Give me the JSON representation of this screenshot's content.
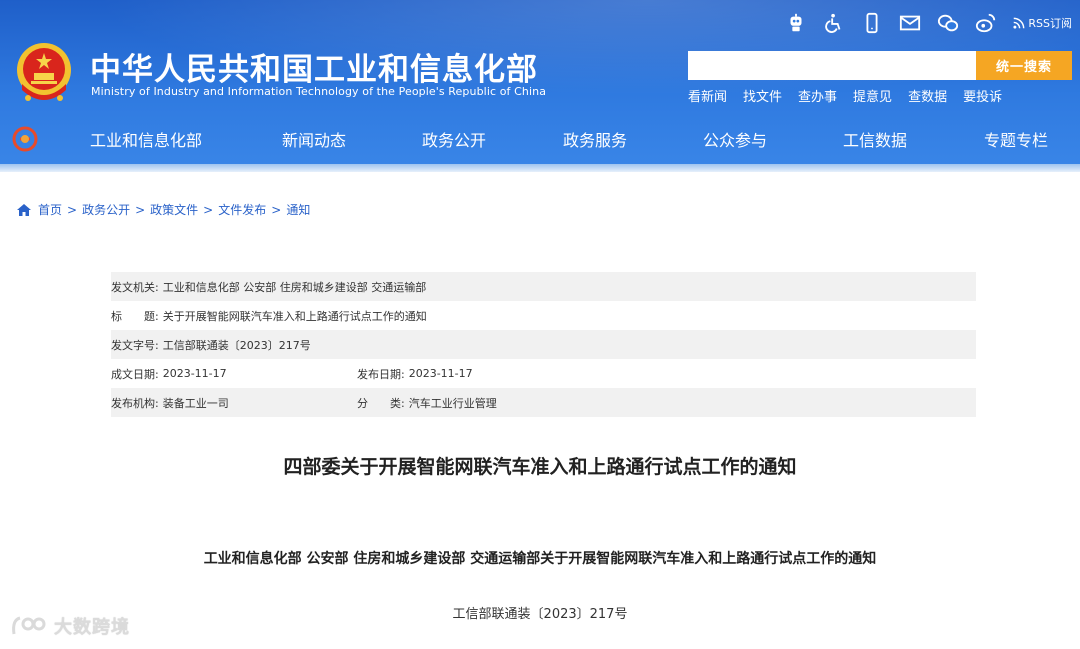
{
  "header": {
    "site_title_cn": "中华人民共和国工业和信息化部",
    "site_title_en": "Ministry of Industry and Information Technology of the People's Republic of China",
    "utility_icons": [
      "robot-icon",
      "accessibility-icon",
      "mobile-icon",
      "mail-icon",
      "wechat-icon",
      "weibo-icon"
    ],
    "rss_label": "RSS订阅",
    "search": {
      "placeholder": "",
      "button_label": "统一搜索"
    },
    "quick_links": [
      "看新闻",
      "找文件",
      "查办事",
      "提意见",
      "查数据",
      "要投诉"
    ],
    "colors": {
      "header_blue": "#2f7ae0",
      "search_button": "#f5a623",
      "link_blue": "#2a62c9"
    }
  },
  "nav": {
    "items": [
      "工业和信息化部",
      "新闻动态",
      "政务公开",
      "政务服务",
      "公众参与",
      "工信数据",
      "专题专栏"
    ]
  },
  "breadcrumb": [
    "首页",
    "政务公开",
    "政策文件",
    "文件发布",
    "通知"
  ],
  "breadcrumb_sep": ">",
  "meta": {
    "issuer_label": "发文机关:",
    "issuer": "工业和信息化部 公安部 住房和城乡建设部 交通运输部",
    "title_label": "标　　题:",
    "title": "关于开展智能网联汽车准入和上路通行试点工作的通知",
    "docno_label": "发文字号:",
    "docno": "工信部联通装〔2023〕217号",
    "created_label": "成文日期:",
    "created": "2023-11-17",
    "published_label": "发布日期:",
    "published": "2023-11-17",
    "org_label": "发布机构:",
    "org": "装备工业一司",
    "category_label": "分　　类:",
    "category": "汽车工业行业管理"
  },
  "article": {
    "title": "四部委关于开展智能网联汽车准入和上路通行试点工作的通知",
    "subtitle": "工业和信息化部 公安部 住房和城乡建设部 交通运输部关于开展智能网联汽车准入和上路通行试点工作的通知",
    "docno": "工信部联通装〔2023〕217号"
  },
  "watermark": {
    "text": "大数跨境"
  }
}
